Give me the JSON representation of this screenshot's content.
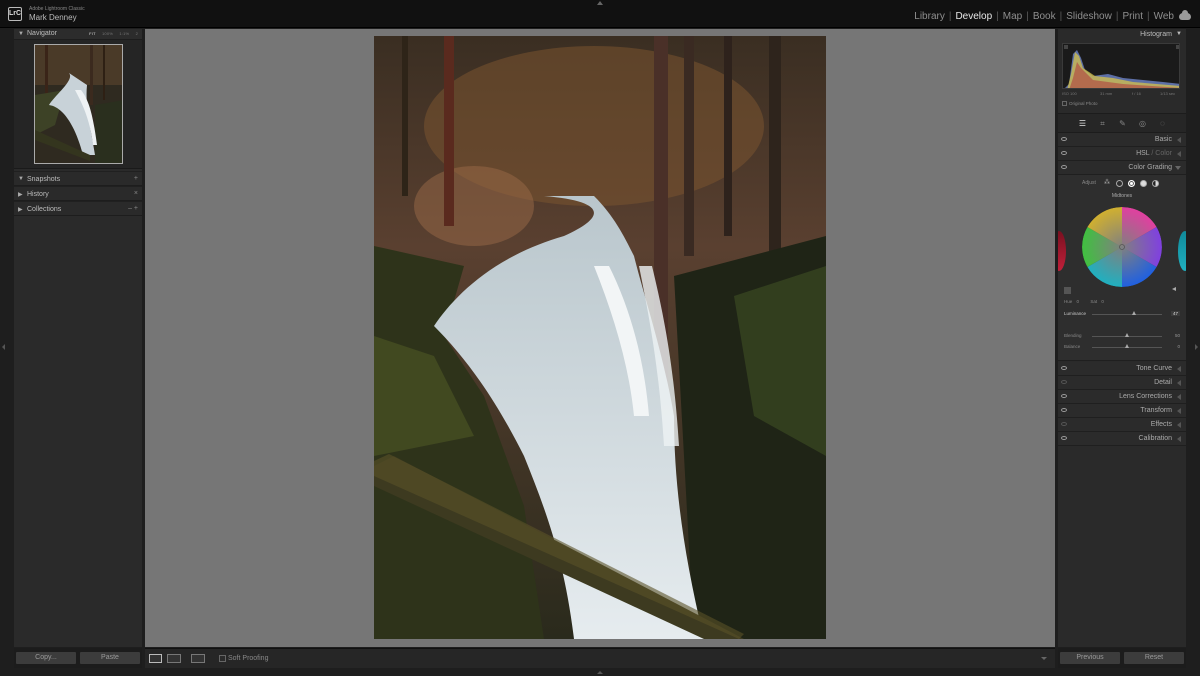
{
  "app": {
    "name": "Adobe Lightroom Classic",
    "user": "Mark Denney",
    "logo_text": "LrC"
  },
  "modules": [
    {
      "label": "Library",
      "active": false
    },
    {
      "label": "Develop",
      "active": true
    },
    {
      "label": "Map",
      "active": false
    },
    {
      "label": "Book",
      "active": false
    },
    {
      "label": "Slideshow",
      "active": false
    },
    {
      "label": "Print",
      "active": false
    },
    {
      "label": "Web",
      "active": false
    }
  ],
  "left_panel": {
    "navigator": {
      "title": "Navigator",
      "zoom_options": [
        "FIT",
        "100%",
        "1:1%",
        "2"
      ]
    },
    "sections": [
      {
        "title": "Snapshots",
        "action": "+"
      },
      {
        "title": "History",
        "action": "×"
      },
      {
        "title": "Collections",
        "action": "– +"
      }
    ],
    "copy_button": "Copy...",
    "paste_button": "Paste"
  },
  "toolbar": {
    "soft_proofing_label": "Soft Proofing"
  },
  "right_panel": {
    "histogram": {
      "title": "Histogram",
      "readout": [
        "ISO 100",
        "31 mm",
        "f / 16",
        "1/13 sec"
      ],
      "original_photo_label": "Original Photo"
    },
    "sections_top": [
      {
        "title": "Basic",
        "expanded": false
      },
      {
        "title": "HSL",
        "suffix": "Color",
        "expanded": false
      },
      {
        "title": "Color Grading",
        "expanded": true
      }
    ],
    "color_grading": {
      "adjust_label": "Adjust",
      "wheel_label": "Midtones",
      "hue_label": "Hue",
      "hue_value": "0",
      "sat_label": "Sat",
      "sat_value": "0",
      "luminance_label": "Luminance",
      "luminance_value": "47",
      "blending_label": "Blending",
      "blending_value": "50",
      "balance_label": "Balance",
      "balance_value": "0"
    },
    "sections_bottom": [
      {
        "title": "Tone Curve"
      },
      {
        "title": "Detail"
      },
      {
        "title": "Lens Corrections"
      },
      {
        "title": "Transform"
      },
      {
        "title": "Effects"
      },
      {
        "title": "Calibration"
      }
    ],
    "previous_button": "Previous",
    "reset_button": "Reset"
  },
  "colors": {
    "accent_active": "#e8e8e8",
    "panel_bg": "#2a2a2a",
    "canvas_bg": "#767676"
  }
}
